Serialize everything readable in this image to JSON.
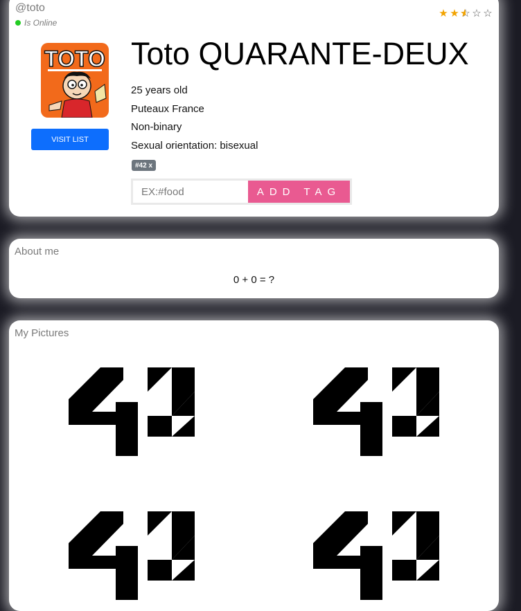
{
  "profile": {
    "username": "@toto",
    "status": "Is Online",
    "status_color": "#22cc22",
    "rating": 2.5,
    "rating_max": 5,
    "avatar_icon": "toto-comic-avatar",
    "avatar_text": "TOTO",
    "visit_button": "VISIT LIST",
    "full_name": "Toto QUARANTE-DEUX",
    "age": "25 years old",
    "location": "Puteaux France",
    "gender": "Non-binary",
    "orientation": "Sexual orientation: bisexual",
    "tags": [
      "#42 x"
    ],
    "tag_input_placeholder": "EX:#food",
    "add_tag_button": "ADD TAG",
    "accent_color": "#e95a91",
    "button_color": "#0d6efd"
  },
  "about": {
    "title": "About me",
    "text": "0 + 0 = ?"
  },
  "pictures": {
    "title": "My Pictures",
    "images": [
      "42-logo",
      "42-logo",
      "42-logo",
      "42-logo"
    ]
  }
}
